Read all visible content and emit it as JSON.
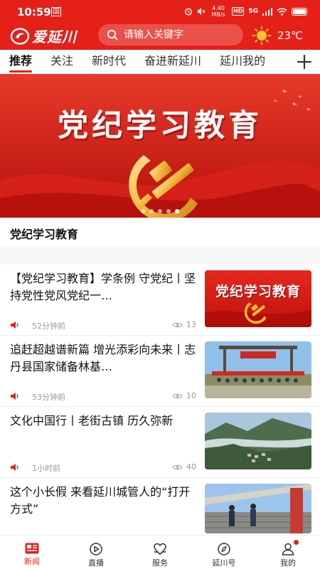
{
  "status": {
    "time": "10:59",
    "sim": "国",
    "speed": "4.40 MB/s",
    "hd": "HD",
    "net": "5G"
  },
  "header": {
    "logo_text": "爱延川",
    "search_placeholder": "请输入关键字",
    "temperature": "23℃"
  },
  "tabs": [
    {
      "label": "推荐",
      "active": true
    },
    {
      "label": "关注",
      "active": false
    },
    {
      "label": "新时代",
      "active": false
    },
    {
      "label": "奋进新延川",
      "active": false
    },
    {
      "label": "延川我的",
      "active": false
    }
  ],
  "banner": {
    "title": "党纪学习教育",
    "caption": "党纪学习教育",
    "dot_count": 5,
    "active_dot": 4
  },
  "news": [
    {
      "title": "【党纪学习教育】学条例 守党纪丨坚持党性党风党纪一…",
      "time": "52分钟前",
      "views": "13",
      "thumb": "red-banner"
    },
    {
      "title": "追赶超越谱新篇 增光添彩向未来丨志丹县国家储备林基…",
      "time": "53分钟前",
      "views": "10",
      "thumb": "group-photo"
    },
    {
      "title": "文化中国行丨老街古镇 历久弥新",
      "time": "1小时前",
      "views": "40",
      "thumb": "mountain-village"
    },
    {
      "title": "这个小长假 来看延川城管人的“打开方式”",
      "time": "",
      "views": "",
      "thumb": "street-workers"
    }
  ],
  "thumb_text": {
    "red_banner": "党纪学习教育"
  },
  "bottom_nav": [
    {
      "label": "新闻",
      "icon": "news-icon",
      "active": true
    },
    {
      "label": "直播",
      "icon": "live-icon",
      "active": false
    },
    {
      "label": "服务",
      "icon": "service-icon",
      "active": false
    },
    {
      "label": "延川号",
      "icon": "compass-icon",
      "active": false
    },
    {
      "label": "我的",
      "icon": "user-icon",
      "active": false,
      "badge": true
    }
  ],
  "colors": {
    "brand_red": "#e52019",
    "meta_gray": "#999999"
  }
}
